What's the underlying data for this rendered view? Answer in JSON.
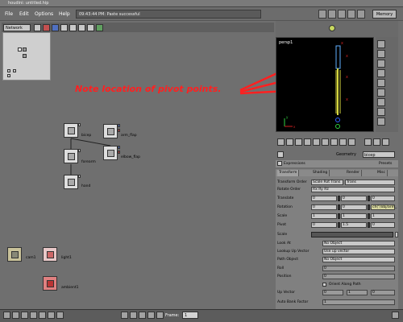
{
  "window": {
    "title": "houdini: untitled.hip"
  },
  "menu": {
    "items": [
      "File",
      "Edit",
      "Options",
      "Help"
    ]
  },
  "status": {
    "message": "09:43:44 PM: Paste successful"
  },
  "memory_label": "Memory",
  "network": {
    "label": "Network"
  },
  "nodes": [
    {
      "label": "bicep"
    },
    {
      "label": "forearm"
    },
    {
      "label": "hand"
    },
    {
      "label": "arm_flap"
    },
    {
      "label": "elbow_flap"
    },
    {
      "label": "cam1"
    },
    {
      "label": "light1"
    },
    {
      "label": "ambient1"
    }
  ],
  "viewport": {
    "camera_label": "persp1"
  },
  "annotation": "Note location of pivot points.",
  "geometry": {
    "label": "Geometry",
    "value": "bicep",
    "expressions_label": "Expressions",
    "presets_label": "Presets"
  },
  "tabs": [
    "Transform",
    "Shading",
    "Render",
    "Misc"
  ],
  "params": {
    "transform_order_label": "Transform Order",
    "transform_order_value_1": "Scale Rot Trans",
    "transform_order_value_2": "Trans",
    "rotate_order_label": "Rotate Order",
    "rotate_order_value": "Rx Ry Rz",
    "translate_label": "Translate",
    "translate": [
      "0",
      "0",
      "0"
    ],
    "rotation_label": "Rotation",
    "rotation": [
      "0",
      "0",
      "ch(\"/obj/arm_"
    ],
    "scale_label": "Scale",
    "scale": [
      "1",
      "1",
      "1"
    ],
    "pivot_label": "Pivot",
    "pivot": [
      "0",
      "1.5",
      "0"
    ],
    "scale2_label": "Scale",
    "scale2": "1",
    "look_at_label": "Look At",
    "look_at_value": "No Object",
    "lookup_vector_label": "Lookup Up Vector",
    "lookup_vector_value": "Use up vector",
    "path_object_label": "Path Object",
    "path_object_value": "No Object",
    "roll_label": "Roll",
    "roll_value": "0",
    "position_label": "Position",
    "position_value": "0",
    "orient_label": "Orient Along Path",
    "up_vector_label": "Up Vector",
    "up_vector": [
      "0",
      "1",
      "0"
    ],
    "auto_bank_label": "Auto Bank Factor",
    "auto_bank_value": "1"
  },
  "bottom": {
    "frame_label": "Frame:",
    "frame_value": "1"
  },
  "colors": {
    "annotation": "#ff2020",
    "viewport_bg": "#000000",
    "bone": "#d8d840",
    "panel": "#808080"
  }
}
